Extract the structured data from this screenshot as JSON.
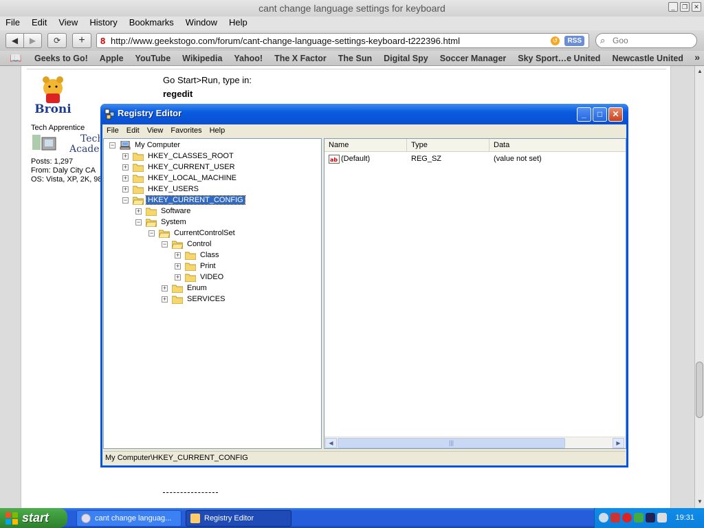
{
  "browser": {
    "window_title": "cant change language settings for keyboard",
    "menu": [
      "File",
      "Edit",
      "View",
      "History",
      "Bookmarks",
      "Window",
      "Help"
    ],
    "address": "http://www.geekstogo.com/forum/cant-change-language-settings-keyboard-t222396.html",
    "rss_label": "RSS",
    "search_placeholder": "Goo",
    "bookmarks": [
      "Geeks to Go!",
      "Apple",
      "YouTube",
      "Wikipedia",
      "Yahoo!",
      "The X Factor",
      "The Sun",
      "Digital Spy",
      "Soccer Manager",
      "Sky Sport…e United",
      "Newcastle United"
    ]
  },
  "page": {
    "post_line1": "Go Start>Run, type in:",
    "post_line2": "regedit",
    "username": "Broni",
    "rank": "Tech Apprentice",
    "badge_text1": "Tech",
    "badge_text2": "Academ",
    "posts": "Posts: 1,297",
    "from": "From: Daly City CA",
    "os": "OS: Vista, XP, 2K, 98"
  },
  "regedit": {
    "title": "Registry Editor",
    "menu": [
      "File",
      "Edit",
      "View",
      "Favorites",
      "Help"
    ],
    "tree": {
      "root": "My Computer",
      "hives": [
        "HKEY_CLASSES_ROOT",
        "HKEY_CURRENT_USER",
        "HKEY_LOCAL_MACHINE",
        "HKEY_USERS",
        "HKEY_CURRENT_CONFIG"
      ],
      "software": "Software",
      "system": "System",
      "ccs": "CurrentControlSet",
      "control": "Control",
      "class": "Class",
      "print": "Print",
      "video": "VIDEO",
      "enum": "Enum",
      "services": "SERVICES"
    },
    "columns": [
      "Name",
      "Type",
      "Data"
    ],
    "values": [
      {
        "name": "(Default)",
        "type": "REG_SZ",
        "data": "(value not set)"
      }
    ],
    "status": "My Computer\\HKEY_CURRENT_CONFIG"
  },
  "taskbar": {
    "start": "start",
    "tasks": [
      "cant change languag...",
      "Registry Editor"
    ],
    "clock": "19:31"
  }
}
